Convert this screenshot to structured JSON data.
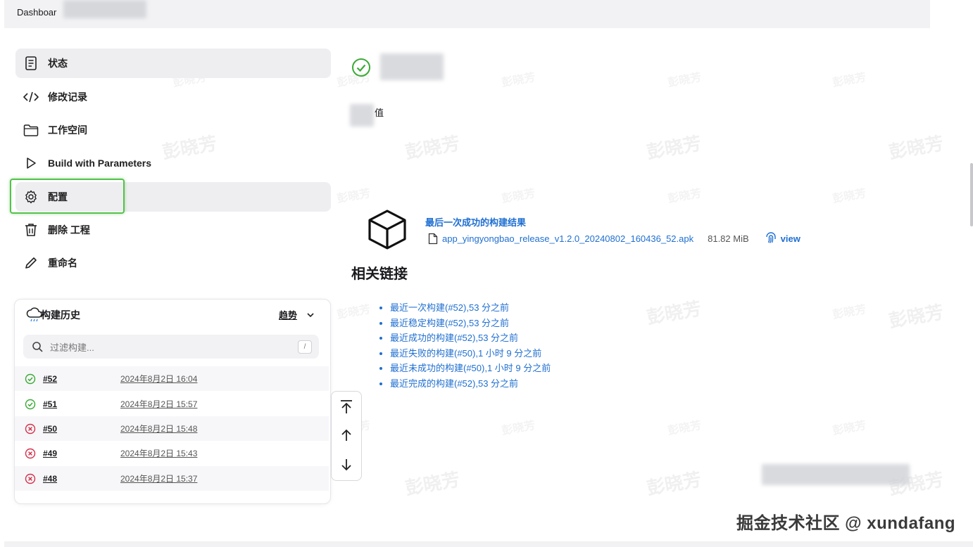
{
  "breadcrumb": {
    "root": "Dashboar"
  },
  "sidebar": {
    "items": [
      {
        "label": "状态"
      },
      {
        "label": "修改记录"
      },
      {
        "label": "工作空间"
      },
      {
        "label": "Build with Parameters"
      },
      {
        "label": "配置"
      },
      {
        "label": "删除 工程"
      },
      {
        "label": "重命名"
      }
    ]
  },
  "build_history": {
    "title": "构建历史",
    "trend_label": "趋势",
    "filter_placeholder": "过滤构建...",
    "filter_shortcut": "/",
    "builds": [
      {
        "number": "#52",
        "time": "2024年8月2日 16:04",
        "status": "success"
      },
      {
        "number": "#51",
        "time": "2024年8月2日 15:57",
        "status": "success"
      },
      {
        "number": "#50",
        "time": "2024年8月2日 15:48",
        "status": "failed"
      },
      {
        "number": "#49",
        "time": "2024年8月2日 15:43",
        "status": "failed"
      },
      {
        "number": "#48",
        "time": "2024年8月2日 15:37",
        "status": "failed"
      }
    ]
  },
  "main": {
    "value_label": "值",
    "artifacts": {
      "title": "最后一次成功的构建结果",
      "file_name": "app_yingyongbao_release_v1.2.0_20240802_160436_52.apk",
      "file_size": "81.82 MiB",
      "view_label": "view"
    },
    "related_links_title": "相关链接",
    "related_links": [
      "最近一次构建(#52),53 分之前",
      "最近稳定构建(#52),53 分之前",
      "最近成功的构建(#52),53 分之前",
      "最近失败的构建(#50),1 小时 9 分之前",
      "最近未成功的构建(#50),1 小时 9 分之前",
      "最近完成的构建(#52),53 分之前"
    ]
  },
  "watermark": {
    "text": "彭晓芳"
  },
  "footer_watermark": "掘金技术社区 @ xundafang",
  "colors": {
    "link": "#1f6fd1",
    "success": "#3aaa35",
    "failed": "#d6304a",
    "highlight": "#53c24a"
  }
}
